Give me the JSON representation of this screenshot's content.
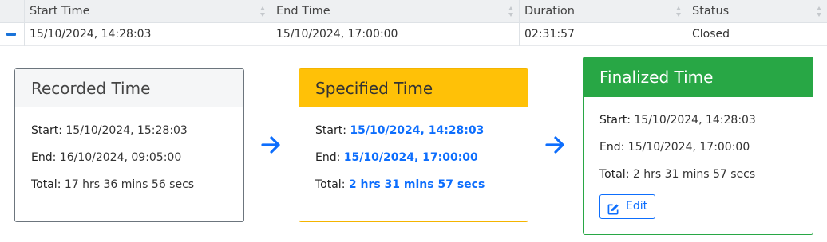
{
  "table": {
    "headers": [
      "",
      "Start Time",
      "End Time",
      "Duration",
      "Status"
    ],
    "row": {
      "start_time": "15/10/2024, 14:28:03",
      "end_time": "15/10/2024, 17:00:00",
      "duration": "02:31:57",
      "status": "Closed"
    }
  },
  "recorded": {
    "title": "Recorded Time",
    "start_label": "Start:",
    "start_value": "15/10/2024, 15:28:03",
    "end_label": "End:",
    "end_value": "16/10/2024, 09:05:00",
    "total_label": "Total:",
    "total_value": "17 hrs 36 mins 56 secs"
  },
  "specified": {
    "title": "Specified Time",
    "start_label": "Start:",
    "start_value": "15/10/2024, 14:28:03",
    "end_label": "End:",
    "end_value": "15/10/2024, 17:00:00",
    "total_label": "Total:",
    "total_value": "2 hrs 31 mins 57 secs"
  },
  "finalized": {
    "title": "Finalized Time",
    "start_label": "Start:",
    "start_value": "15/10/2024, 14:28:03",
    "end_label": "End:",
    "end_value": "15/10/2024, 17:00:00",
    "total_label": "Total:",
    "total_value": "2 hrs 31 mins 57 secs",
    "edit_label": "Edit"
  },
  "icons": {
    "arrow": "arrow-right-icon",
    "edit": "edit-icon",
    "collapse": "minus-icon"
  },
  "colors": {
    "primary": "#0d6efd",
    "warning": "#ffc107",
    "success": "#28a745",
    "secondary": "#6c757d"
  }
}
